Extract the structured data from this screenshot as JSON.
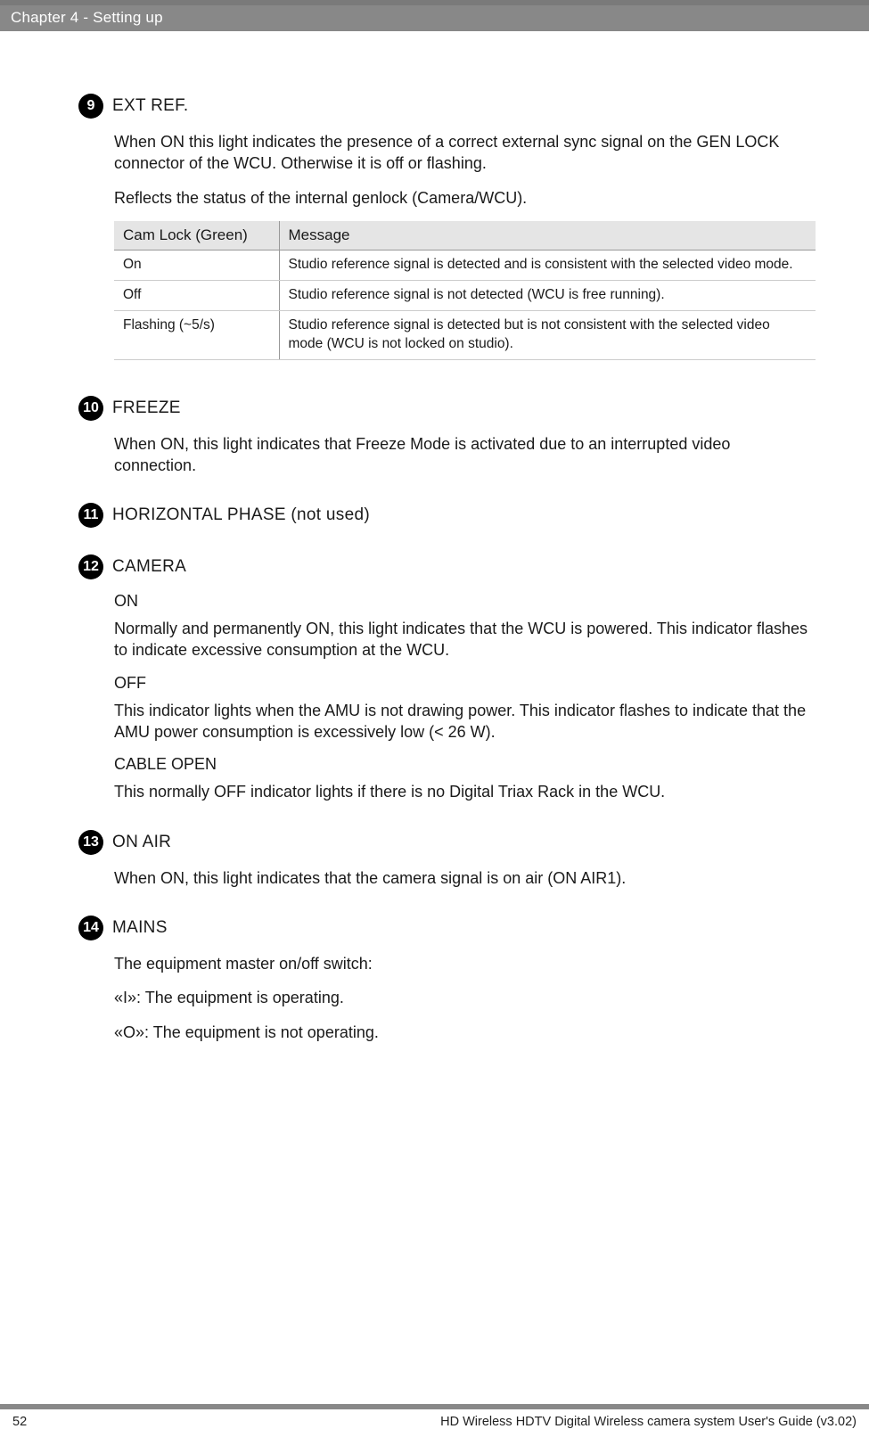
{
  "header": {
    "chapter": "Chapter 4  - Setting up"
  },
  "sections": {
    "extref": {
      "num": "9",
      "title": "EXT REF.",
      "p1": "When ON this light indicates the presence of a correct external sync signal on the GEN LOCK connector of the WCU. Otherwise it is off or flashing.",
      "p2": "Reflects the status of the internal genlock (Camera/WCU).",
      "th1": "Cam Lock (Green)",
      "th2": "Message",
      "rows": [
        {
          "c1": "On",
          "c2": "Studio reference signal is detected and is consistent with the selected video mode."
        },
        {
          "c1": "Off",
          "c2": "Studio reference signal is not detected (WCU is free running)."
        },
        {
          "c1": "Flashing (~5/s)",
          "c2": "Studio reference signal is detected but is not consistent with the selected video mode (WCU is not locked on studio)."
        }
      ]
    },
    "freeze": {
      "num": "10",
      "title": "FREEZE",
      "p1": "When ON, this light indicates that Freeze Mode is activated due to an interrupted video connection."
    },
    "hphase": {
      "num": "11",
      "title": "HORIZONTAL PHASE (not used)"
    },
    "camera": {
      "num": "12",
      "title": "CAMERA",
      "on_label": "ON",
      "on_text": "Normally and permanently ON, this light indicates that the WCU is powered. This indicator flashes to indicate excessive consumption at the WCU.",
      "off_label": "OFF",
      "off_text": "This indicator lights when the AMU is not drawing power. This indicator flashes to indicate that the AMU power consumption is excessively low (< 26 W).",
      "cable_label": "CABLE OPEN",
      "cable_text": "This normally OFF indicator lights if there is no Digital Triax Rack in the WCU."
    },
    "onair": {
      "num": "13",
      "title": "ON AIR",
      "p1": "When ON, this light indicates that the camera signal is on air (ON AIR1)."
    },
    "mains": {
      "num": "14",
      "title": "MAINS",
      "p1": "The equipment master on/off switch:",
      "p2": "«I»: The equipment is operating.",
      "p3": "«O»: The equipment is not operating."
    }
  },
  "footer": {
    "page_num": "52",
    "doc_title": "HD Wireless HDTV Digital Wireless camera system User's Guide (v3.02)"
  }
}
